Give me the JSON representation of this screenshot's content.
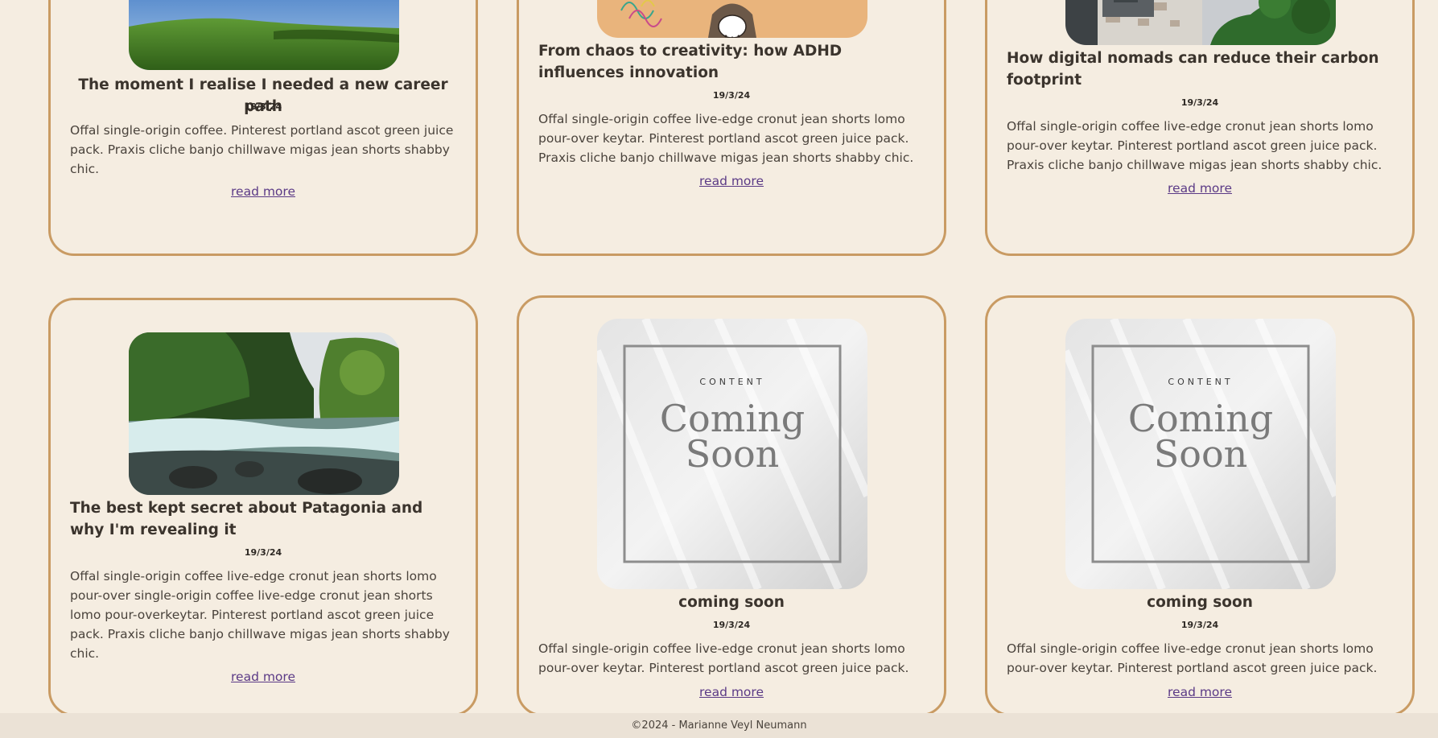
{
  "posts": [
    {
      "title": "The moment I realise I needed a new career path",
      "date": "19/3/24",
      "excerpt": "Offal single-origin coffee. Pinterest portland ascot green juice pack. Praxis cliche banjo chillwave migas jean shorts shabby chic.",
      "read_more": "read more"
    },
    {
      "title": "From chaos to creativity: how ADHD influences innovation",
      "date": "19/3/24",
      "excerpt": "Offal single-origin coffee live-edge cronut jean shorts lomo pour-over keytar. Pinterest portland ascot green juice pack. Praxis cliche banjo chillwave migas jean shorts shabby chic.",
      "read_more": "read more"
    },
    {
      "title": "How digital nomads can reduce their carbon footprint",
      "date": "19/3/24",
      "excerpt": "Offal single-origin coffee live-edge cronut jean shorts lomo pour-over keytar. Pinterest portland ascot green juice pack. Praxis cliche banjo chillwave migas jean shorts shabby chic.",
      "read_more": "read more"
    },
    {
      "title": "The best kept secret about Patagonia and why I'm revealing it",
      "date": "19/3/24",
      "excerpt": "Offal single-origin coffee live-edge cronut jean shorts lomo pour-over single-origin coffee live-edge cronut jean shorts lomo pour-overkeytar. Pinterest portland ascot green juice pack. Praxis cliche banjo chillwave migas jean shorts shabby chic.",
      "read_more": "read more"
    },
    {
      "title": "coming soon",
      "date": "19/3/24",
      "excerpt": "Offal single-origin coffee live-edge cronut jean shorts lomo pour-over keytar. Pinterest portland ascot green juice pack.",
      "read_more": "read more",
      "image_label": "CONTENT",
      "image_title_1": "Coming",
      "image_title_2": "Soon"
    },
    {
      "title": "coming soon",
      "date": "19/3/24",
      "excerpt": "Offal single-origin coffee live-edge cronut jean shorts lomo pour-over keytar. Pinterest portland ascot green juice pack.",
      "read_more": "read more",
      "image_label": "CONTENT",
      "image_title_1": "Coming",
      "image_title_2": "Soon"
    }
  ],
  "footer": {
    "text": "©2024 - Marianne Veyl Neumann"
  },
  "colors": {
    "background": "#f5ede1",
    "card_border": "#c99b63",
    "link": "#5b3a86",
    "footer_bg": "#ebe2d6"
  }
}
